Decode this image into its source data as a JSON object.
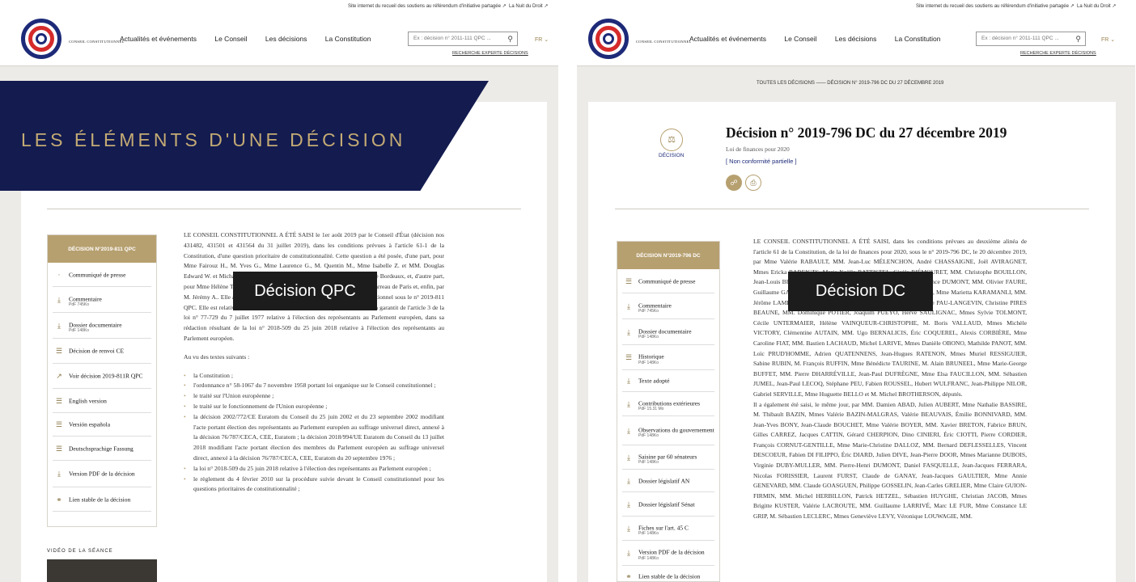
{
  "topbar": {
    "link1": "Site internet du recueil des soutiens au référendum d'initiative partagée ↗",
    "link2": "La Nuit du Droit ↗"
  },
  "header": {
    "logo_text": "CONSEIL CONSTITUTIONNEL",
    "nav": [
      "Actualités et événements",
      "Le Conseil",
      "Les décisions",
      "La Constitution"
    ],
    "search_placeholder": "Ex : décision n° 2011-111 QPC ...",
    "lang": "FR ⌄",
    "advanced": "RECHERCHE EXPERTE DÉCISIONS"
  },
  "left": {
    "banner_title": "LES ÉLÉMENTS D'UNE DÉCISION",
    "menu_title": "DÉCISION N°2019-811 QPC",
    "menu": [
      {
        "label": "Communiqué de presse",
        "size": "",
        "icon": "dot-icon"
      },
      {
        "label": "Commentaire",
        "size": "PdF 745Ko",
        "icon": "download-icon"
      },
      {
        "label": "Dossier documentaire",
        "size": "PdF 148Ko",
        "icon": "download-icon"
      },
      {
        "label": "Décision de renvoi CE",
        "size": "",
        "icon": "document-icon"
      },
      {
        "label": "Voir décision 2019-811R QPC",
        "size": "",
        "icon": "external-link-icon"
      },
      {
        "label": "English version",
        "size": "",
        "icon": "document-icon"
      },
      {
        "label": "Versión española",
        "size": "",
        "icon": "document-icon"
      },
      {
        "label": "Deutschsprachige Fassung",
        "size": "",
        "icon": "document-icon"
      },
      {
        "label": "Version PDF de la décision",
        "size": "",
        "icon": "download-icon"
      },
      {
        "label": "Lien stable de la décision",
        "size": "",
        "icon": "link-icon"
      }
    ],
    "body_p1": "LE CONSEIL CONSTITUTIONNEL A ÉTÉ SAISI le 1er août 2019 par le Conseil d'État (décision nos 431482, 431501 et 431564 du 31 juillet 2019), dans les conditions prévues à l'article 61-1 de la Constitution, d'une question prioritaire de constitutionnalité. Cette question a été posée, d'une part, pour Mme Fairouz H., M. Yves G., Mme Laurence G., M. Quentin M., Mme Isabelle Z. et MM. Douglas Edward W. et Michael Charles S. par Me Julien Fouchet, avocat au barreau de Bordeaux, et, d'autre part, pour Mme Hélène T. et le parti animaliste par Me Hélène Thouy, avocate au barreau de Paris et, enfin, par M. Jérémy A.. Elle a été enregistrée au secrétariat général du Conseil constitutionnel sous le n° 2019-811 QPC. Elle est relative à la conformité aux droits et libertés que la Constitution garantit de l'article 3 de la loi n° 77-729 du 7 juillet 1977 relative à l'élection des représentants au Parlement européen, dans sa rédaction résultant de la loi n° 2018-509 du 25 juin 2018 relative à l'élection des représentants au Parlement européen.",
    "body_p2": "Au vu des textes suivants :",
    "body_list": [
      "la Constitution ;",
      "l'ordonnance n° 58-1067 du 7 novembre 1958 portant loi organique sur le Conseil constitutionnel ;",
      "le traité sur l'Union européenne ;",
      "le traité sur le fonctionnement de l'Union européenne ;",
      "la décision 2002/772/CE Euratom du Conseil du 25 juin 2002 et du 23 septembre 2002 modifiant l'acte portant élection des représentants au Parlement européen au suffrage universel direct, annexé à la décision 76/787/CECA, CEE, Euratom ; la décision 2018/994/UE Euratom du Conseil du 13 juillet 2018 modifiant l'acte portant élection des membres du Parlement européen au suffrage universel direct, annexé à la décision 76/787/CECA, CEE, Euratom du 20 septembre 1976 ;",
      "la loi n° 2018-509 du 25 juin 2018 relative à l'élection des représentants au Parlement européen ;",
      "le règlement du 4 février 2010 sur la procédure suivie devant le Conseil constitutionnel pour les questions prioritaires de constitutionnalité ;"
    ],
    "overlay": "Décision QPC",
    "video_label": "VIDÉO DE LA SÉANCE"
  },
  "right": {
    "breadcrumb_root": "TOUTES LES DÉCISIONS",
    "breadcrumb_current": "DÉCISION N° 2019-796 DC DU 27 DÉCEMBRE 2019",
    "icon_label": "DÉCISION",
    "title": "Décision n° 2019-796 DC du 27 décembre 2019",
    "subtitle": "Loi de finances pour 2020",
    "tag": "[ Non conformité partielle ]",
    "menu_title": "DÉCISION N°2019-796 DC",
    "menu": [
      {
        "label": "Communiqué de presse",
        "size": "",
        "icon": "document-icon"
      },
      {
        "label": "Commentaire",
        "size": "PdF 745Ko",
        "icon": "download-icon"
      },
      {
        "label": "Dossier documentaire",
        "size": "PdF 148Ko",
        "icon": "download-icon"
      },
      {
        "label": "Historique",
        "size": "PdF 148Ko",
        "icon": "document-icon"
      },
      {
        "label": "Texte adopté",
        "size": "",
        "icon": "download-icon"
      },
      {
        "label": "Contributions extérieures",
        "size": "PdF 15.31 Mo",
        "icon": "download-icon"
      },
      {
        "label": "Observations du gouvernement",
        "size": "PdF 148Ko",
        "icon": "download-icon"
      },
      {
        "label": "Saisine par 60 sénateurs",
        "size": "PdF 148Ko",
        "icon": "download-icon"
      },
      {
        "label": "Dossier législatif AN",
        "size": "",
        "icon": "download-icon"
      },
      {
        "label": "Dossier législatif Sénat",
        "size": "",
        "icon": "download-icon"
      },
      {
        "label": "Fiches sur l'art. 45 C",
        "size": "PdF 148Ko",
        "icon": "download-icon"
      },
      {
        "label": "Version PDF de la décision",
        "size": "PdF 148Ko",
        "icon": "download-icon"
      },
      {
        "label": "Lien stable de la décision",
        "size": "",
        "icon": "link-icon"
      }
    ],
    "body_p1": "LE CONSEIL CONSTITUTIONNEL A ÉTÉ SAISI, dans les conditions prévues au deuxième alinéa de l'article 61 de la Constitution, de la loi de finances pour 2020, sous le n° 2019-796 DC, le 20 décembre 2019, par Mme Valérie RABAULT, MM. Jean-Luc MÉLENCHON, André CHASSAIGNE, Joël AVIRAGNET, Mmes Ericka BAREIGTS, Marie-Noëlle BATTISTEL, Gisèle BIÉMOURET, MM. Christophe BOUILLON, Jean-Louis BRICOUT, Luc CARVOUNAS, Alain DAVID, Mme Laurence DUMONT, MM. Olivier FAURE, Guillaume GAROT, David HABIB, Christian HUTIN, Régis JUANICO, Mme Marietta KARAMANLI, MM. Jérôme LAMBERT, Serge LETCHIMY, Mmes Josette MANIN, George PAU-LANGEVIN, Christine PIRES BEAUNE, MM. Dominique POTIER, Joaquim PUEYO, Hervé SAULIGNAC, Mmes Sylvie TOLMONT, Cécile UNTERMAIER, Hélène VAINQUEUR-CHRISTOPHE, M. Boris VALLAUD, Mmes Michèle VICTORY, Clémentine AUTAIN, MM. Ugo BERNALICIS, Éric COQUEREL, Alexis CORBIÈRE, Mme Caroline FIAT, MM. Bastien LACHAUD, Michel LARIVE, Mmes Danièle OBONO, Mathilde PANOT, MM. Loïc PRUD'HOMME, Adrien QUATENNENS, Jean-Hugues RATENON, Mmes Muriel RESSIGUIER, Sabine RUBIN, M. François RUFFIN, Mme Bénédicte TAURINE, M. Alain BRUNEEL, Mme Marie-George BUFFET, MM. Pierre DHARRÉVILLE, Jean-Paul DUFRÈGNE, Mme Elsa FAUCILLON, MM. Sébastien JUMEL, Jean-Paul LECOQ, Stéphane PEU, Fabien ROUSSEL, Hubert WULFRANC, Jean-Philippe NILOR, Gabriel SERVILLE, Mme Huguette BELLO et M. Michel BROTHERSON, députés.",
    "body_p2": "Il a également été saisi, le même jour, par MM. Damien ABAD, Julien AUBERT, Mme Nathalie BASSIRE, M. Thibault BAZIN, Mmes Valérie BAZIN-MALGRAS, Valérie BEAUVAIS, Émilie BONNIVARD, MM. Jean-Yves BONY, Jean-Claude BOUCHET, Mme Valérie BOYER, MM. Xavier BRETON, Fabrice BRUN, Gilles CARREZ, Jacques CATTIN, Gérard CHERPION, Dino CINIERI, Éric CIOTTI, Pierre CORDIER, François CORNUT-GENTILLE, Mme Marie-Christine DALLOZ, MM. Bernard DEFLESSELLES, Vincent DESCOEUR, Fabien DI FILIPPO, Éric DIARD, Julien DIVE, Jean-Pierre DOOR, Mmes Marianne DUBOIS, Virginie DUBY-MULLER, MM. Pierre-Henri DUMONT, Daniel FASQUELLE, Jean-Jacques FERRARA, Nicolas FORISSIER, Laurent FURST, Claude de GANAY, Jean-Jacques GAULTIER, Mme Annie GENEVARD, MM. Claude GOASGUEN, Philippe GOSSELIN, Jean-Carles GRELIER, Mme Claire GUION-FIRMIN, MM. Michel HERBILLON, Patrick HETZEL, Sébastien HUYGHE, Christian JACOB, Mmes Brigitte KUSTER, Valérie LACROUTE, MM. Guillaume LARRIVÉ, Marc LE FUR, Mme Constance LE GRIP, M. Sébastien LECLERC, Mmes Geneviève LEVY, Véronique LOUWAGIE, MM.",
    "overlay": "Décision DC"
  },
  "colors": {
    "navy": "#131b4f",
    "gold": "#b7a070",
    "red": "#d52b2b",
    "overlay": "#1c1c1c"
  }
}
